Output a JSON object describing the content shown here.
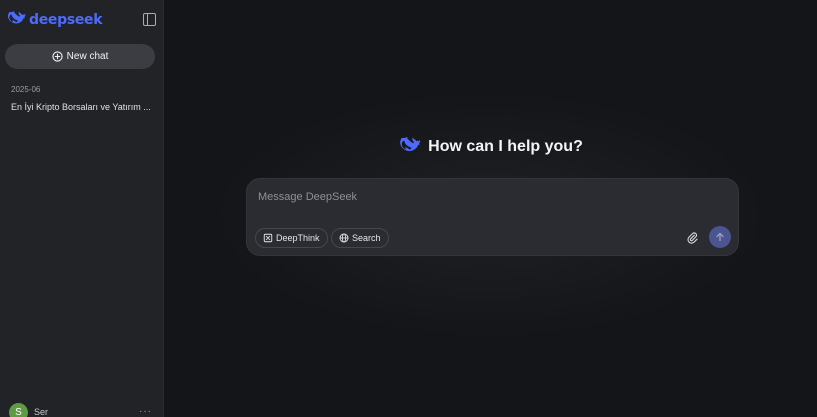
{
  "brand": {
    "name": "deepseek",
    "color": "#4d6bfe"
  },
  "sidebar": {
    "new_chat_label": "New chat",
    "groups": [
      {
        "date": "2025-06",
        "items": [
          {
            "title": "En İyi Kripto Borsaları ve Yatırım ..."
          }
        ]
      }
    ],
    "user": {
      "initial": "S",
      "name": "Ser",
      "more": "···"
    }
  },
  "main": {
    "greeting": "How can I help you?",
    "composer": {
      "placeholder": "Message DeepSeek",
      "value": "",
      "deepthink_label": "DeepThink",
      "search_label": "Search"
    }
  },
  "icons": [
    "whale-logo-icon",
    "sidebar-toggle-icon",
    "plus-circle-icon",
    "deepthink-icon",
    "globe-icon",
    "paperclip-icon",
    "arrow-up-icon",
    "more-icon"
  ]
}
